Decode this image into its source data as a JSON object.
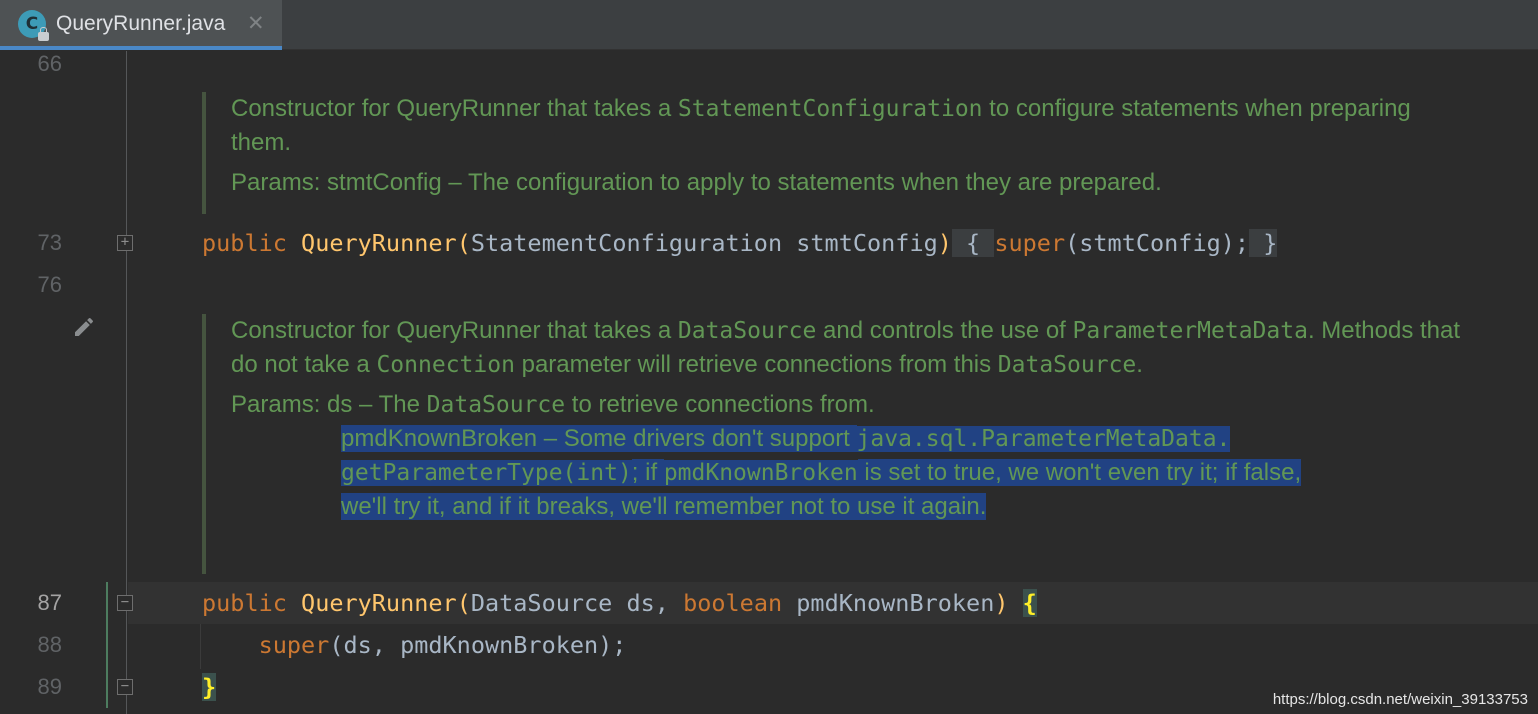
{
  "tab": {
    "icon_letter": "C",
    "title": "QueryRunner.java",
    "close": "✕"
  },
  "gutter": {
    "lines": [
      "66",
      "73",
      "76",
      "87",
      "88",
      "89"
    ],
    "fold_collapsed": "+",
    "fold_expanded": "−"
  },
  "doc1": {
    "t1": "Constructor for QueryRunner that takes a ",
    "c1": "StatementConfiguration",
    "t2": " to configure statements when preparing them.",
    "params_label": "Params: ",
    "params_text": "stmtConfig – The configuration to apply to statements when they are prepared."
  },
  "code73": {
    "kw_public": "public",
    "fn_name": "QueryRunner",
    "open_paren": "(",
    "args": "StatementConfiguration stmtConfig",
    "close_paren": ")",
    "brace_open": "{",
    "kw_super": "super",
    "super_args": "(stmtConfig);",
    "brace_close": "}"
  },
  "doc2": {
    "t1": "Constructor for QueryRunner that takes a ",
    "c1": "DataSource",
    "t2": " and controls the use of ",
    "c2": "ParameterMetaData",
    "t3": ". Methods that do not take a ",
    "c3": "Connection",
    "t4": " parameter will retrieve connections from this ",
    "c4": "DataSource",
    "t5": ".",
    "params_label": "Params: ",
    "p1a": "ds – The ",
    "p1c": "DataSource",
    "p1b": " to retrieve connections from.",
    "p2a": "pmdKnownBroken – Some drivers don't support ",
    "p2c": "java.sql.ParameterMetaData.",
    "p3c": "getParameterType(int)",
    "p3a": "; if ",
    "p3c2": "pmdKnownBroken",
    "p3b": " is set to true, we won't even try it; if false,",
    "p4": "we'll try it, and if it breaks, we'll remember not to use it again."
  },
  "code87": {
    "kw_public": "public",
    "fn_name": "QueryRunner",
    "open_paren": "(",
    "type1": "DataSource",
    "arg1": " ds, ",
    "kw_boolean": "boolean",
    "arg2": " pmdKnownBroken",
    "close_paren": ")",
    "brace_open": "{"
  },
  "code88": {
    "kw_super": "super",
    "args": "(ds, pmdKnownBroken);"
  },
  "code89": {
    "brace_close": "}"
  },
  "watermark": "https://blog.csdn.net/weixin_39133753"
}
